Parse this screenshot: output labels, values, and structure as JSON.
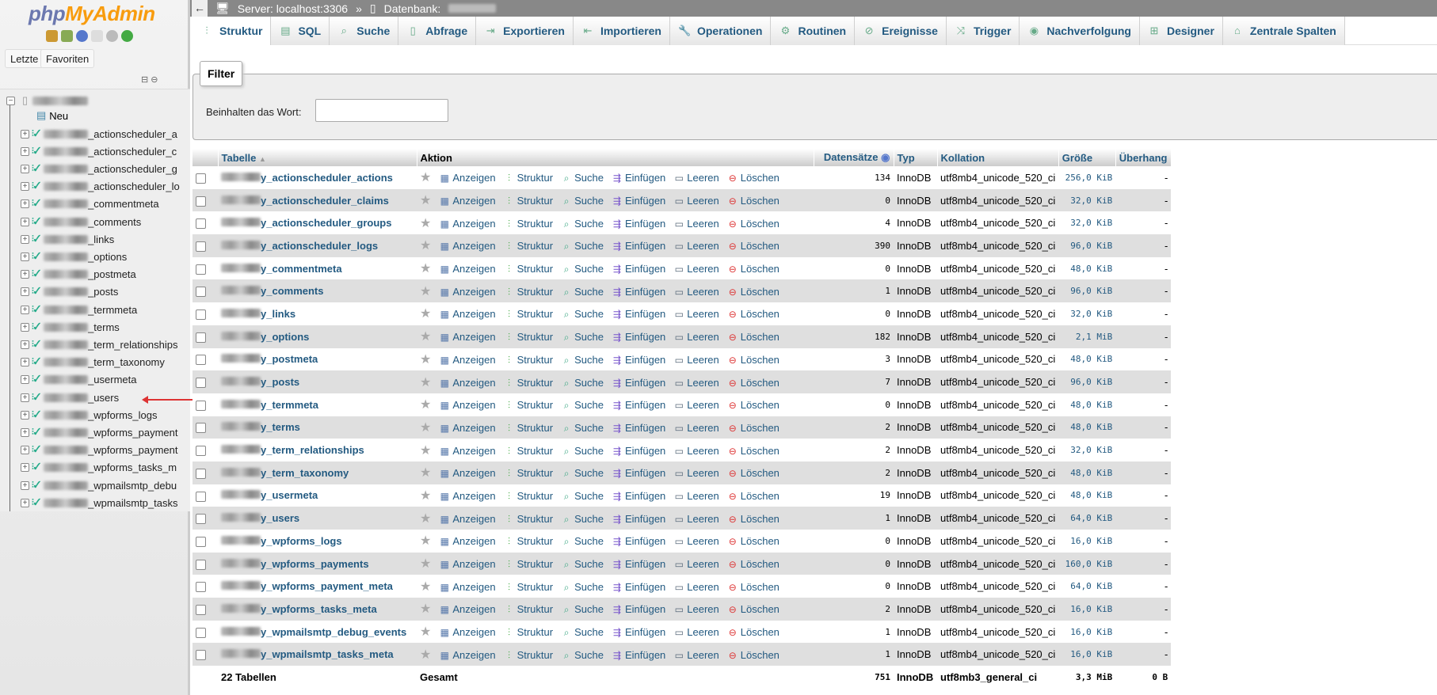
{
  "logo": {
    "php": "php",
    "my": "MyAdmin"
  },
  "sidebar": {
    "recent": "Letzte",
    "favorites": "Favoriten",
    "new": "Neu",
    "tables": [
      "_actionscheduler_a",
      "_actionscheduler_c",
      "_actionscheduler_g",
      "_actionscheduler_lo",
      "_commentmeta",
      "_comments",
      "_links",
      "_options",
      "_postmeta",
      "_posts",
      "_termmeta",
      "_terms",
      "_term_relationships",
      "_term_taxonomy",
      "_usermeta",
      "_users",
      "_wpforms_logs",
      "_wpforms_payment",
      "_wpforms_payment",
      "_wpforms_tasks_m",
      "_wpmailsmtp_debu",
      "_wpmailsmtp_tasks"
    ]
  },
  "breadcrumb": {
    "server": "Server: localhost:3306",
    "sep": "»",
    "database": "Datenbank:"
  },
  "tabs": [
    {
      "label": "Struktur",
      "icon": "structure-icon"
    },
    {
      "label": "SQL",
      "icon": "sql-icon"
    },
    {
      "label": "Suche",
      "icon": "search-icon"
    },
    {
      "label": "Abfrage",
      "icon": "query-icon"
    },
    {
      "label": "Exportieren",
      "icon": "export-icon"
    },
    {
      "label": "Importieren",
      "icon": "import-icon"
    },
    {
      "label": "Operationen",
      "icon": "wrench-icon"
    },
    {
      "label": "Routinen",
      "icon": "routines-icon"
    },
    {
      "label": "Ereignisse",
      "icon": "clock-icon"
    },
    {
      "label": "Trigger",
      "icon": "trigger-icon"
    },
    {
      "label": "Nachverfolgung",
      "icon": "eye-icon"
    },
    {
      "label": "Designer",
      "icon": "designer-icon"
    },
    {
      "label": "Zentrale Spalten",
      "icon": "columns-icon"
    }
  ],
  "filter": {
    "legend": "Filter",
    "label": "Beinhalten das Wort:",
    "value": ""
  },
  "table": {
    "headers": {
      "table": "Tabelle",
      "action": "Aktion",
      "rows": "Datensätze",
      "type": "Typ",
      "collation": "Kollation",
      "size": "Größe",
      "overhead": "Überhang"
    },
    "actions": [
      "Anzeigen",
      "Struktur",
      "Suche",
      "Einfügen",
      "Leeren",
      "Löschen"
    ],
    "rows": [
      [
        "y_actionscheduler_actions",
        "134",
        "InnoDB",
        "utf8mb4_unicode_520_ci",
        "256,0 KiB",
        "-"
      ],
      [
        "y_actionscheduler_claims",
        "0",
        "InnoDB",
        "utf8mb4_unicode_520_ci",
        "32,0 KiB",
        "-"
      ],
      [
        "y_actionscheduler_groups",
        "4",
        "InnoDB",
        "utf8mb4_unicode_520_ci",
        "32,0 KiB",
        "-"
      ],
      [
        "y_actionscheduler_logs",
        "390",
        "InnoDB",
        "utf8mb4_unicode_520_ci",
        "96,0 KiB",
        "-"
      ],
      [
        "y_commentmeta",
        "0",
        "InnoDB",
        "utf8mb4_unicode_520_ci",
        "48,0 KiB",
        "-"
      ],
      [
        "y_comments",
        "1",
        "InnoDB",
        "utf8mb4_unicode_520_ci",
        "96,0 KiB",
        "-"
      ],
      [
        "y_links",
        "0",
        "InnoDB",
        "utf8mb4_unicode_520_ci",
        "32,0 KiB",
        "-"
      ],
      [
        "y_options",
        "182",
        "InnoDB",
        "utf8mb4_unicode_520_ci",
        "2,1 MiB",
        "-"
      ],
      [
        "y_postmeta",
        "3",
        "InnoDB",
        "utf8mb4_unicode_520_ci",
        "48,0 KiB",
        "-"
      ],
      [
        "y_posts",
        "7",
        "InnoDB",
        "utf8mb4_unicode_520_ci",
        "96,0 KiB",
        "-"
      ],
      [
        "y_termmeta",
        "0",
        "InnoDB",
        "utf8mb4_unicode_520_ci",
        "48,0 KiB",
        "-"
      ],
      [
        "y_terms",
        "2",
        "InnoDB",
        "utf8mb4_unicode_520_ci",
        "48,0 KiB",
        "-"
      ],
      [
        "y_term_relationships",
        "2",
        "InnoDB",
        "utf8mb4_unicode_520_ci",
        "32,0 KiB",
        "-"
      ],
      [
        "y_term_taxonomy",
        "2",
        "InnoDB",
        "utf8mb4_unicode_520_ci",
        "48,0 KiB",
        "-"
      ],
      [
        "y_usermeta",
        "19",
        "InnoDB",
        "utf8mb4_unicode_520_ci",
        "48,0 KiB",
        "-"
      ],
      [
        "y_users",
        "1",
        "InnoDB",
        "utf8mb4_unicode_520_ci",
        "64,0 KiB",
        "-"
      ],
      [
        "y_wpforms_logs",
        "0",
        "InnoDB",
        "utf8mb4_unicode_520_ci",
        "16,0 KiB",
        "-"
      ],
      [
        "y_wpforms_payments",
        "0",
        "InnoDB",
        "utf8mb4_unicode_520_ci",
        "160,0 KiB",
        "-"
      ],
      [
        "y_wpforms_payment_meta",
        "0",
        "InnoDB",
        "utf8mb4_unicode_520_ci",
        "64,0 KiB",
        "-"
      ],
      [
        "y_wpforms_tasks_meta",
        "2",
        "InnoDB",
        "utf8mb4_unicode_520_ci",
        "16,0 KiB",
        "-"
      ],
      [
        "y_wpmailsmtp_debug_events",
        "1",
        "InnoDB",
        "utf8mb4_unicode_520_ci",
        "16,0 KiB",
        "-"
      ],
      [
        "y_wpmailsmtp_tasks_meta",
        "1",
        "InnoDB",
        "utf8mb4_unicode_520_ci",
        "16,0 KiB",
        "-"
      ]
    ],
    "footer": {
      "count": "22 Tabellen",
      "label": "Gesamt",
      "rows": "751",
      "type": "InnoDB",
      "collation": "utf8mb3_general_ci",
      "size": "3,3 MiB",
      "overhead": "0 B"
    }
  }
}
